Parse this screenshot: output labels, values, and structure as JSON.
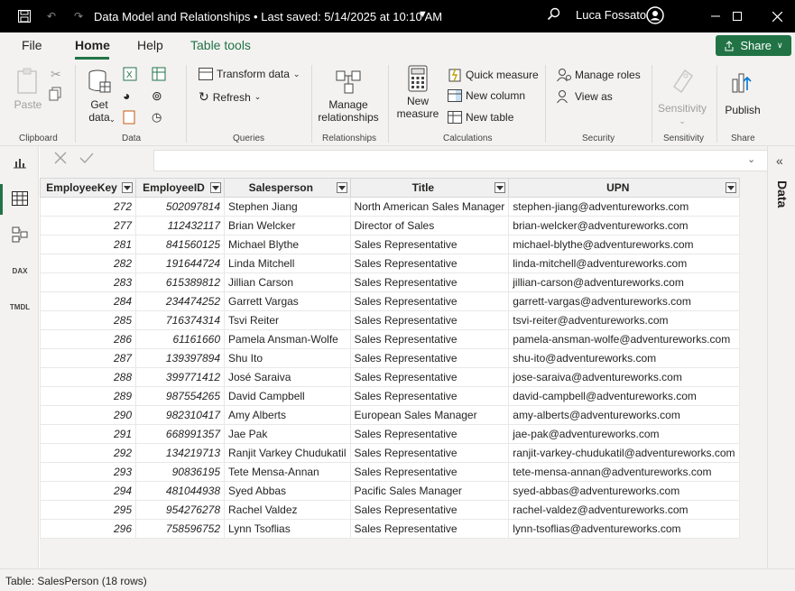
{
  "window": {
    "title": "Data Model and Relationships • Last saved: 5/14/2025 at 10:10 AM",
    "user": "Luca Fossato"
  },
  "menu": {
    "items": [
      "File",
      "Home",
      "Help",
      "Table tools"
    ],
    "active": "Home",
    "share_label": "Share"
  },
  "ribbon": {
    "clipboard": {
      "label": "Clipboard",
      "paste": "Paste"
    },
    "data": {
      "label": "Data",
      "get_data_1": "Get",
      "get_data_2": "data"
    },
    "queries": {
      "label": "Queries",
      "transform": "Transform data",
      "refresh": "Refresh"
    },
    "relationships": {
      "label": "Relationships",
      "manage_1": "Manage",
      "manage_2": "relationships"
    },
    "calculations": {
      "label": "Calculations",
      "new_measure_1": "New",
      "new_measure_2": "measure",
      "quick_measure": "Quick measure",
      "new_column": "New column",
      "new_table": "New table"
    },
    "security": {
      "label": "Security",
      "manage_roles": "Manage roles",
      "view_as": "View as"
    },
    "sensitivity": {
      "label": "Sensitivity",
      "button": "Sensitivity"
    },
    "share": {
      "label": "Share",
      "publish": "Publish"
    }
  },
  "right_pane": {
    "label": "Data"
  },
  "table": {
    "columns": [
      "EmployeeKey",
      "EmployeeID",
      "Salesperson",
      "Title",
      "UPN"
    ],
    "rows": [
      [
        "272",
        "502097814",
        "Stephen Jiang",
        "North American Sales Manager",
        "stephen-jiang@adventureworks.com"
      ],
      [
        "277",
        "112432117",
        "Brian Welcker",
        "Director of Sales",
        "brian-welcker@adventureworks.com"
      ],
      [
        "281",
        "841560125",
        "Michael Blythe",
        "Sales Representative",
        "michael-blythe@adventureworks.com"
      ],
      [
        "282",
        "191644724",
        "Linda Mitchell",
        "Sales Representative",
        "linda-mitchell@adventureworks.com"
      ],
      [
        "283",
        "615389812",
        "Jillian Carson",
        "Sales Representative",
        "jillian-carson@adventureworks.com"
      ],
      [
        "284",
        "234474252",
        "Garrett Vargas",
        "Sales Representative",
        "garrett-vargas@adventureworks.com"
      ],
      [
        "285",
        "716374314",
        "Tsvi Reiter",
        "Sales Representative",
        "tsvi-reiter@adventureworks.com"
      ],
      [
        "286",
        "61161660",
        "Pamela Ansman-Wolfe",
        "Sales Representative",
        "pamela-ansman-wolfe@adventureworks.com"
      ],
      [
        "287",
        "139397894",
        "Shu Ito",
        "Sales Representative",
        "shu-ito@adventureworks.com"
      ],
      [
        "288",
        "399771412",
        "José Saraiva",
        "Sales Representative",
        "jose-saraiva@adventureworks.com"
      ],
      [
        "289",
        "987554265",
        "David Campbell",
        "Sales Representative",
        "david-campbell@adventureworks.com"
      ],
      [
        "290",
        "982310417",
        "Amy Alberts",
        "European Sales Manager",
        "amy-alberts@adventureworks.com"
      ],
      [
        "291",
        "668991357",
        "Jae Pak",
        "Sales Representative",
        "jae-pak@adventureworks.com"
      ],
      [
        "292",
        "134219713",
        "Ranjit Varkey Chudukatil",
        "Sales Representative",
        "ranjit-varkey-chudukatil@adventureworks.com"
      ],
      [
        "293",
        "90836195",
        "Tete Mensa-Annan",
        "Sales Representative",
        "tete-mensa-annan@adventureworks.com"
      ],
      [
        "294",
        "481044938",
        "Syed Abbas",
        "Pacific Sales Manager",
        "syed-abbas@adventureworks.com"
      ],
      [
        "295",
        "954276278",
        "Rachel Valdez",
        "Sales Representative",
        "rachel-valdez@adventureworks.com"
      ],
      [
        "296",
        "758596752",
        "Lynn Tsoflias",
        "Sales Representative",
        "lynn-tsoflias@adventureworks.com"
      ]
    ]
  },
  "status": {
    "text": "Table: SalesPerson (18 rows)"
  },
  "colors": {
    "accent": "#217346",
    "titlebar": "#000000",
    "ribbon": "#f3f2f1"
  }
}
